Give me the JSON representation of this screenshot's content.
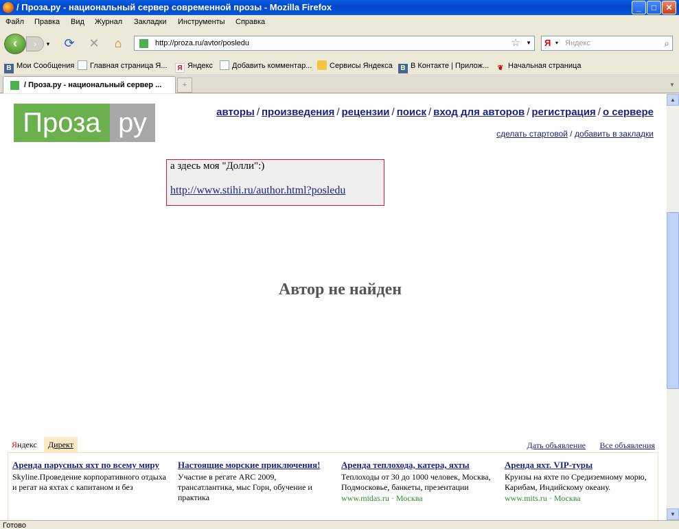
{
  "window": {
    "title": "/ Проза.ру - национальный сервер современной прозы - Mozilla Firefox"
  },
  "menu": [
    "Файл",
    "Правка",
    "Вид",
    "Журнал",
    "Закладки",
    "Инструменты",
    "Справка"
  ],
  "address": {
    "url": "http://proza.ru/avtor/posledu",
    "search_placeholder": "Яндекс",
    "search_engine": "Я"
  },
  "bookmarks": [
    {
      "label": "Мои Сообщения",
      "icon": "vk-icon"
    },
    {
      "label": "Главная страница Я...",
      "icon": "page-icon"
    },
    {
      "label": "Яндекс",
      "icon": "yandex-icon"
    },
    {
      "label": "Добавить комментар...",
      "icon": "page-icon"
    },
    {
      "label": "Сервисы Яндекса",
      "icon": "folder-icon"
    },
    {
      "label": "В Контакте | Прилож...",
      "icon": "vk-icon"
    },
    {
      "label": "Начальная страница",
      "icon": "red-bird-icon"
    }
  ],
  "tab": {
    "title": "/ Проза.ру - национальный сервер ..."
  },
  "logo": {
    "left": "Проза",
    "right": "ру"
  },
  "nav": [
    "авторы",
    "произведения",
    "рецензии",
    "поиск",
    "вход для авторов",
    "регистрация",
    "о сервере"
  ],
  "subnav": {
    "start": "сделать стартовой",
    "sep": "/",
    "bookmark": "добавить в закладки"
  },
  "note": {
    "text": "а здесь моя \"Долли\":)",
    "link": "http://www.stihi.ru/author.html?posledu"
  },
  "message": "Автор не найден",
  "ads": {
    "brand_first": "Я",
    "brand_rest": "ндекс",
    "direct": "Директ",
    "give_ad": "Дать объявление",
    "all_ads": "Все объявления",
    "items": [
      {
        "title": "Аренда парусных яхт по всему миру",
        "desc": "Skyline.Проведение корпоративного отдыха и регат на яхтах с капитаном и без",
        "site": ""
      },
      {
        "title": "Настоящие морские приключения!",
        "desc": "Участие в регате ARC 2009, трансатлантика, мыс Горн, обучение и практика",
        "site": ""
      },
      {
        "title": "Аренда теплохода, катера, яхты",
        "desc": "Теплоходы от 30 до 1000 человек, Москва, Подмосковье, банкеты, презентации",
        "site": "www.midas.ru · Москва"
      },
      {
        "title": "Аренда яхт. VIP-туры",
        "desc": "Круизы на яхте по Средиземному морю, Карибам, Индийскому океану.",
        "site": "www.mits.ru · Москва"
      }
    ]
  },
  "status": "Готово"
}
